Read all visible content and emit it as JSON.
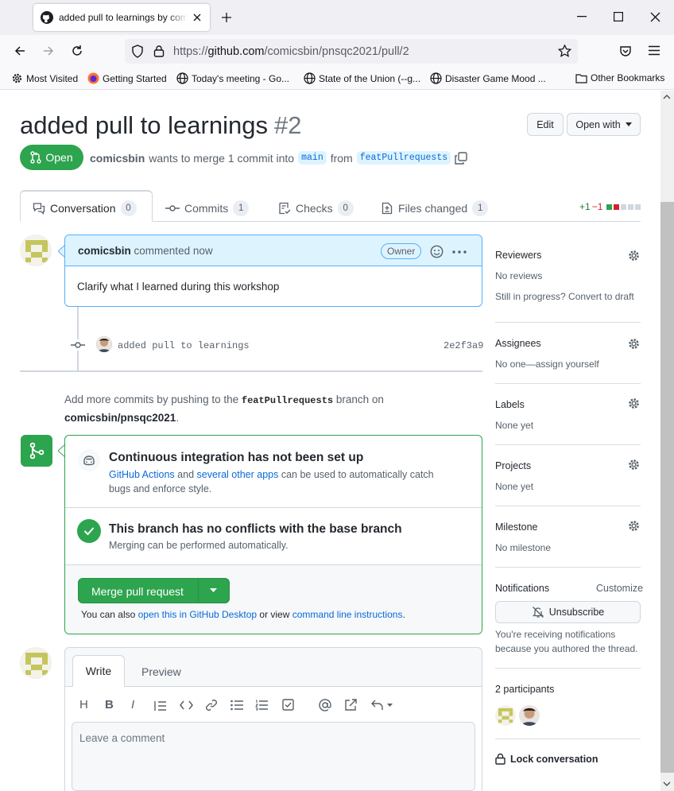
{
  "browser": {
    "tab_title": "added pull to learnings by comicsbin",
    "url_prefix": "https://",
    "url_host": "github.com",
    "url_path": "/comicsbin/pnsqc2021/pull/2",
    "bookmarks": [
      "Most Visited",
      "Getting Started",
      "Today's meeting - Go...",
      "State of the Union (--g...",
      "Disaster Game Mood ...",
      "Other Bookmarks"
    ]
  },
  "pr": {
    "title": "added pull to learnings",
    "number": "#2",
    "edit_label": "Edit",
    "open_with_label": "Open with",
    "state": "Open",
    "author": "comicsbin",
    "meta_text": "wants to merge 1 commit into",
    "base_branch": "main",
    "from_text": "from",
    "head_branch": "featPullrequests"
  },
  "tabs": [
    {
      "label": "Conversation",
      "count": "0"
    },
    {
      "label": "Commits",
      "count": "1"
    },
    {
      "label": "Checks",
      "count": "0"
    },
    {
      "label": "Files changed",
      "count": "1"
    }
  ],
  "diffstat": {
    "added": "+1",
    "removed": "−1"
  },
  "comment": {
    "author": "comicsbin",
    "action": "commented now",
    "role": "Owner",
    "body": "Clarify what I learned during this workshop"
  },
  "commit": {
    "message": "added pull to learnings",
    "sha": "2e2f3a9"
  },
  "push_hint": {
    "prefix": "Add more commits by pushing to the",
    "branch": "featPullrequests",
    "suffix": "branch on",
    "repo": "comicsbin/pnsqc2021"
  },
  "ci": {
    "title": "Continuous integration has not been set up",
    "link1": "GitHub Actions",
    "and": "and",
    "link2": "several other apps",
    "rest1": "can be used to automatically catch",
    "rest2": "bugs and enforce style."
  },
  "conflicts": {
    "title": "This branch has no conflicts with the base branch",
    "subtitle": "Merging can be performed automatically."
  },
  "merge": {
    "button": "Merge pull request",
    "also_prefix": "You can also",
    "link1": "open this in GitHub Desktop",
    "or_view": "or view",
    "link2": "command line instructions",
    "period": "."
  },
  "editor": {
    "tab_write": "Write",
    "tab_preview": "Preview",
    "heading_tool": "H",
    "bold_tool": "B",
    "italic_tool": "I",
    "placeholder": "Leave a comment"
  },
  "sidebar": {
    "reviewers": {
      "label": "Reviewers",
      "value": "No reviews",
      "hint": "Still in progress? Convert to draft"
    },
    "assignees": {
      "label": "Assignees",
      "value": "No one—assign yourself"
    },
    "labels": {
      "label": "Labels",
      "value": "None yet"
    },
    "projects": {
      "label": "Projects",
      "value": "None yet"
    },
    "milestone": {
      "label": "Milestone",
      "value": "No milestone"
    },
    "notifications": {
      "label": "Notifications",
      "customize": "Customize",
      "button": "Unsubscribe",
      "line1": "You're receiving notifications",
      "line2": "because you authored the thread."
    },
    "participants": "2 participants",
    "lock": "Lock conversation"
  },
  "colors": {
    "green": "#2da44e",
    "blue": "#0969da",
    "red": "#cf222e"
  }
}
